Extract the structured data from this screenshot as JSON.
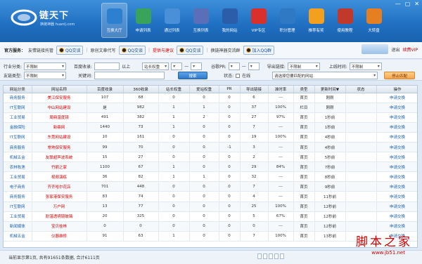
{
  "window": {
    "minimize": "—",
    "maximize": "▢",
    "close": "✕"
  },
  "brand": {
    "name": "链天下",
    "subtitle": "换链神器 huanlj.com"
  },
  "nav": [
    {
      "label": "互换大厅",
      "color": "#2d7fcf",
      "icon": "hall-icon"
    },
    {
      "label": "申请列表",
      "color": "#3aa35b",
      "icon": "globe-icon"
    },
    {
      "label": "通过列表",
      "color": "#4a90d9",
      "icon": "list-icon"
    },
    {
      "label": "互换列表",
      "color": "#5a6fb8",
      "icon": "exchange-icon"
    },
    {
      "label": "我的网站",
      "color": "#2a5ea8",
      "icon": "monitor-icon"
    },
    {
      "label": "VIP专区",
      "color": "#d9302c",
      "icon": "vip-icon"
    },
    {
      "label": "积分管理",
      "color": "#2f78c4",
      "icon": "coins-icon"
    },
    {
      "label": "推荐有奖",
      "color": "#f2a01e",
      "icon": "star-icon"
    },
    {
      "label": "使用教程",
      "color": "#c0392b",
      "icon": "book-icon"
    },
    {
      "label": "大转盘",
      "color": "#e67e22",
      "icon": "wheel-icon"
    }
  ],
  "service": {
    "label": "官方服务：",
    "item1": "友情链接托管",
    "qq1": "QQ交谈",
    "item2": "原创文章代写",
    "qq2": "QQ交谈",
    "item3": "提供与建议",
    "qq3": "QQ交谈",
    "item4": "换链神器交流群",
    "qq4": "加入QQ群"
  },
  "user": {
    "exit": "退出",
    "vip": "续费VIP"
  },
  "filters": {
    "industry_label": "行业分类:",
    "industry_value": "不限制",
    "baidu_label": "百度收录:",
    "baidu_above": "以上",
    "weight_value": "站长权重",
    "range_sep1": "—",
    "google_label": "谷歌PR:",
    "range_sep2": "—",
    "outlinks_label": "导出链接:",
    "outlinks_value": "不限制",
    "online_label": "上线时间:",
    "online_value": "不限制",
    "type_label": "友链类型:",
    "type_value": "不限制",
    "keyword_label": "关键词:",
    "search_btn": "搜索",
    "status_label": "状态:",
    "online_chk": "在线",
    "match_value": "请选择您要匹配的网站",
    "reset_btn": "停止匹配"
  },
  "table": {
    "headers": [
      "网站分类",
      "网站名称",
      "百度收录",
      "360收录",
      "站长权重",
      "爱站权重",
      "PR",
      "导出链接",
      "准时率",
      "类型",
      "更新时间▼",
      "状态",
      "操作"
    ],
    "rows": [
      [
        "商务服务",
        "美江保安服务",
        "107",
        "68",
        "0",
        "0",
        "0",
        "6",
        "---",
        "首页",
        "刚刚",
        "",
        "申请交换"
      ],
      [
        "IT互联网",
        "中山网站建设",
        "是",
        "982",
        "1",
        "1",
        "0",
        "37",
        "100%",
        "栏目",
        "刚刚",
        "",
        "申请交换"
      ],
      [
        "工业贸易",
        "周鼎温度镜",
        "491",
        "382",
        "1",
        "2",
        "0",
        "27",
        "97%",
        "首页",
        "1秒前",
        "",
        "申请交换"
      ],
      [
        "金融保险",
        "新鼎网",
        "1440",
        "73",
        "1",
        "0",
        "0",
        "7",
        "---",
        "首页",
        "1秒前",
        "",
        "申请交换"
      ],
      [
        "IT互联网",
        "东莞网站建设",
        "10",
        "161",
        "0",
        "0",
        "0",
        "19",
        "100%",
        "首页",
        "4秒前",
        "",
        "申请交换"
      ],
      [
        "商务服务",
        "常熟保安服务",
        "99",
        "70",
        "0",
        "0",
        "-1",
        "3",
        "---",
        "首页",
        "4秒前",
        "",
        "申请交换"
      ],
      [
        "机械五金",
        "友联超声波系统",
        "15",
        "27",
        "0",
        "0",
        "0",
        "2",
        "---",
        "首页",
        "5秒前",
        "",
        "申请交换"
      ],
      [
        "农林牧渔",
        "竹箭之家",
        "1100",
        "67",
        "1",
        "0",
        "0",
        "29",
        "84%",
        "首页",
        "7秒前",
        "",
        "申请交换"
      ],
      [
        "工业贸易",
        "视频演练",
        "36",
        "82",
        "1",
        "1",
        "0",
        "32",
        "---",
        "首页",
        "8秒前",
        "",
        "申请交换"
      ],
      [
        "电子商务",
        "齐齐哈尔花店",
        "701",
        "448",
        "0",
        "0",
        "0",
        "7",
        "---",
        "首页",
        "9秒前",
        "",
        "申请交换"
      ],
      [
        "商务服务",
        "张家港保安服务",
        "83",
        "74",
        "0",
        "0",
        "0",
        "4",
        "---",
        "首页",
        "11秒前",
        "",
        "申请交换"
      ],
      [
        "IT互联网",
        "万户网",
        "13",
        "77",
        "0",
        "0",
        "0",
        "25",
        "100%",
        "首页",
        "12秒前",
        "",
        "申请交换"
      ],
      [
        "工业贸易",
        "耐温透明镜玻璃",
        "20",
        "325",
        "0",
        "0",
        "0",
        "5",
        "67%",
        "首页",
        "12秒前",
        "",
        "申请交换"
      ],
      [
        "新闻媒体",
        "宝贝桂林",
        "0",
        "0",
        "0",
        "0",
        "0",
        "0",
        "---",
        "首页",
        "12秒前",
        "",
        "申请交换"
      ],
      [
        "机械五金",
        "仪器维修",
        "91",
        "63",
        "1",
        "0",
        "0",
        "7",
        "100%",
        "首页",
        "13秒前",
        "",
        "申请交换"
      ]
    ]
  },
  "footer": {
    "summary": "当前显示第1页, 共有91651条数据, 合计6111页"
  },
  "watermark": {
    "title": "脚本之家",
    "url": "www.jb51.net"
  }
}
